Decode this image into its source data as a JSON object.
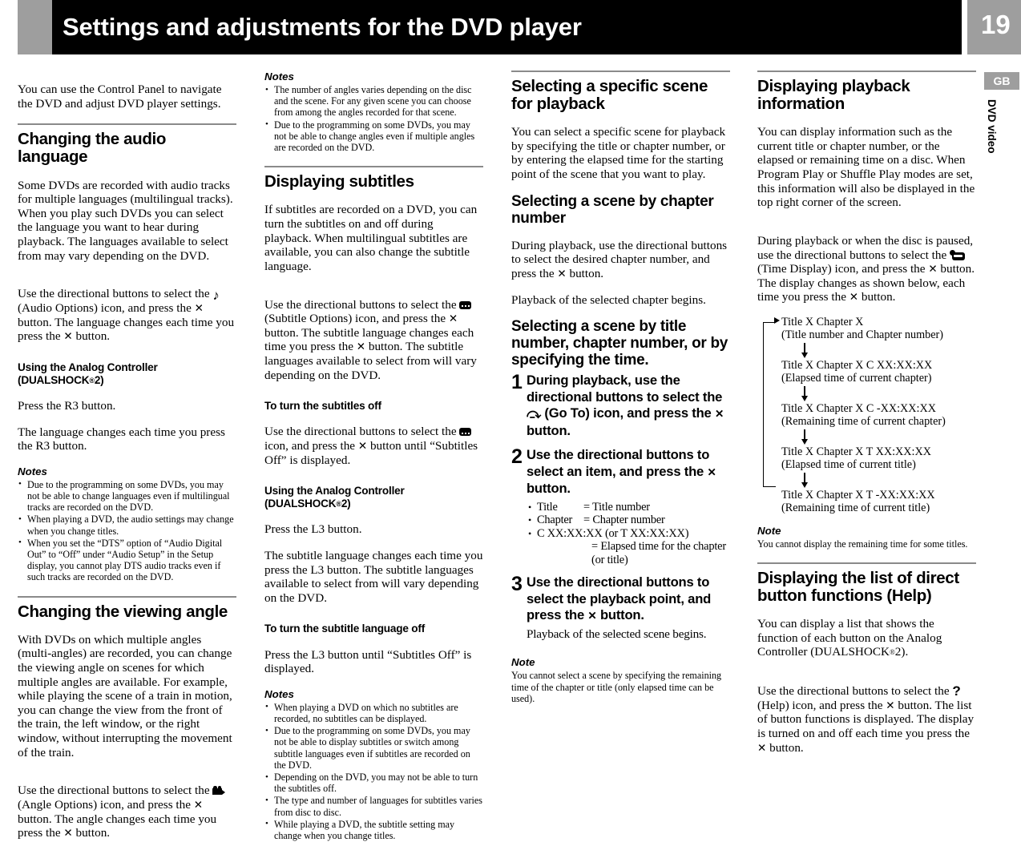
{
  "header": {
    "title": "Settings and adjustments for the DVD player",
    "page_number": "19"
  },
  "side_tab": {
    "region_code": "GB",
    "media_label": "DVD video"
  },
  "col1": {
    "intro": "You can use the Control Panel to navigate the DVD and adjust DVD player settings.",
    "s1_title": "Changing the audio language",
    "s1_p1": "Some DVDs are recorded with audio tracks for multiple languages (multilingual tracks). When you play such DVDs you can select the language you want to hear during playback. The languages available to select from may vary depending on the DVD.",
    "s1_p2a": "Use the directional buttons to select the",
    "s1_p2b": "(Audio Options) icon, and press the",
    "s1_p2c": "button. The language changes each time you press the",
    "s1_p2d": "button.",
    "s1_sub": "Using the Analog Controller (DUALSHOCK",
    "s1_sub_tail": "2)",
    "s1_sub_p": "Press the R3 button.",
    "s1_sub_p2": "The language changes each time you press the R3 button.",
    "notes_label": "Notes",
    "notes": [
      "Due to the programming on some DVDs, you may not be able to change languages even if multilingual tracks are recorded on the DVD.",
      "When playing a DVD, the audio settings may change when you change titles.",
      "When you set the “DTS” option of “Audio Digital Out” to “Off” under “Audio Setup” in the Setup display, you cannot play DTS audio tracks even if such tracks are recorded on the DVD."
    ],
    "s2_title": "Changing the viewing angle",
    "s2_p1": "With DVDs on which multiple angles (multi-angles) are recorded, you can change the viewing angle on scenes for which multiple angles are available. For example, while playing the scene of a train in motion, you can change the view from the front of the train, the left window, or the right window, without interrupting the movement of the train.",
    "s2_p2a": "Use the directional buttons to select the",
    "s2_p2b": "(Angle Options) icon, and press the",
    "s2_p2c": "button. The angle changes each time you press the",
    "s2_p2d": "button."
  },
  "col2": {
    "notes_label": "Notes",
    "notes": [
      "The number of angles varies depending on the disc and the scene. For any given scene you can choose from among the angles recorded for that scene.",
      "Due to the programming on some DVDs, you may not be able to change angles even if multiple angles are recorded on the DVD."
    ],
    "s1_title": "Displaying subtitles",
    "s1_p1": "If subtitles are recorded on a DVD, you can turn the subtitles on and off during playback. When multilingual subtitles are available, you can also change the subtitle language.",
    "s1_p2a": "Use the directional buttons to select the",
    "s1_p2b": "(Subtitle Options) icon, and press the",
    "s1_p2c": "button. The subtitle language changes each time you press the",
    "s1_p2d": "button. The subtitle languages available to select from will vary depending on the DVD.",
    "s2_title": "To turn the subtitles off",
    "s2_p1a": "Use the directional buttons to select the",
    "s2_p1b": "icon, and press the",
    "s2_p1c": "button until “Subtitles Off” is displayed.",
    "s3_title": "Using the Analog Controller (DUALSHOCK",
    "s3_title_tail": "2)",
    "s3_p1": "Press the L3 button.",
    "s3_p2": "The subtitle language changes each time you press the L3 button. The subtitle languages available to select from will vary depending on the DVD.",
    "s4_title": "To turn the subtitle language off",
    "s4_p1": "Press the L3 button until “Subtitles Off” is displayed.",
    "notes2_label": "Notes",
    "notes2": [
      "When playing a DVD on which no subtitles are recorded, no subtitles can be displayed.",
      "Due to the programming on some DVDs, you may not be able to display subtitles or switch among subtitle languages even if subtitles are recorded on the DVD.",
      "Depending on the DVD, you may not be able to turn the subtitles off.",
      "The type and number of languages for subtitles varies from disc to disc.",
      "While playing a DVD, the subtitle setting may change when you change titles."
    ]
  },
  "col3": {
    "s1_title": "Selecting a specific scene for playback",
    "s1_p1": "You can select a specific scene for playback by specifying the title or chapter number, or by entering the elapsed time for the starting point of the scene that you want to play.",
    "s2_title": "Selecting a scene by chapter number",
    "s2_p1a": "During playback, use the directional buttons to select the desired chapter number, and press the",
    "s2_p1b": "button.",
    "s2_p2": "Playback of the selected chapter begins.",
    "s3_title": "Selecting a scene by title number, chapter number, or by specifying the time.",
    "step1_num": "1",
    "step1_a": "During playback, use the directional buttons to select the",
    "step1_b": "(Go To) icon, and press the",
    "step1_c": "button.",
    "step2_num": "2",
    "step2_a": "Use the directional buttons to select an item, and press the",
    "step2_b": "button.",
    "step2_bullets": [
      {
        "term": "Title",
        "def": "= Title number"
      },
      {
        "term": "Chapter",
        "def": "= Chapter number"
      }
    ],
    "step2_bullet3": "C XX:XX:XX (or T XX:XX:XX)",
    "step2_bullet3_def": "= Elapsed time for the chapter (or title)",
    "step3_num": "3",
    "step3_a": "Use the directional buttons to select the playback point, and press the",
    "step3_b": "button.",
    "step3_after": "Playback of the selected scene begins.",
    "note_label": "Note",
    "note_body": "You cannot select a scene by specifying the remaining time of the chapter or title (only elapsed time can be used)."
  },
  "col4": {
    "s1_title": "Displaying playback information",
    "s1_p1": "You can display information such as the current title or chapter number, or the elapsed or remaining time on a disc. When Program Play or Shuffle Play modes are set, this information will also be displayed in the top right corner of the screen.",
    "s1_p2a": "During playback or when the disc is paused, use the directional buttons to select the",
    "s1_p2b": "(Time Display) icon, and press the",
    "s1_p2c": "button. The display changes as shown below, each time you press the",
    "s1_p2d": "button.",
    "flow": [
      {
        "line1": "Title X  Chapter X",
        "line2": "(Title number and Chapter number)"
      },
      {
        "line1": "Title X Chapter X  C XX:XX:XX",
        "line2": "(Elapsed time of current chapter)"
      },
      {
        "line1": "Title X Chapter X  C -XX:XX:XX",
        "line2": "(Remaining time of current chapter)"
      },
      {
        "line1": "Title X Chapter X  T XX:XX:XX",
        "line2": "(Elapsed time of current title)"
      },
      {
        "line1": "Title X Chapter X  T -XX:XX:XX",
        "line2": "(Remaining time of current title)"
      }
    ],
    "note_label": "Note",
    "note_body": "You cannot display the remaining time for some titles.",
    "s2_title": "Displaying the list of direct button functions (Help)",
    "s2_p1": "You can display a list that shows the function of each button on the Analog Controller (DUALSHOCK",
    "s2_p1_tail": "2).",
    "s2_p2a": "Use the directional buttons to select the",
    "s2_p2b": "(Help) icon, and press the",
    "s2_p2c": "button. The list of button functions is displayed. The display is turned on and off each time you press the",
    "s2_p2d": "button."
  },
  "icons": {
    "audio_options": "music-note-icon",
    "angle_options": "camera-icon",
    "subtitle_options": "subtitle-icon",
    "time_display": "time-display-icon",
    "go_to": "go-to-arrow-icon",
    "help": "help-question-icon",
    "cross_button": "cross-button-icon"
  },
  "colors": {
    "header_black": "#000000",
    "accent_gray": "#9e9e9e",
    "rule_gray": "#8a8a8a"
  }
}
